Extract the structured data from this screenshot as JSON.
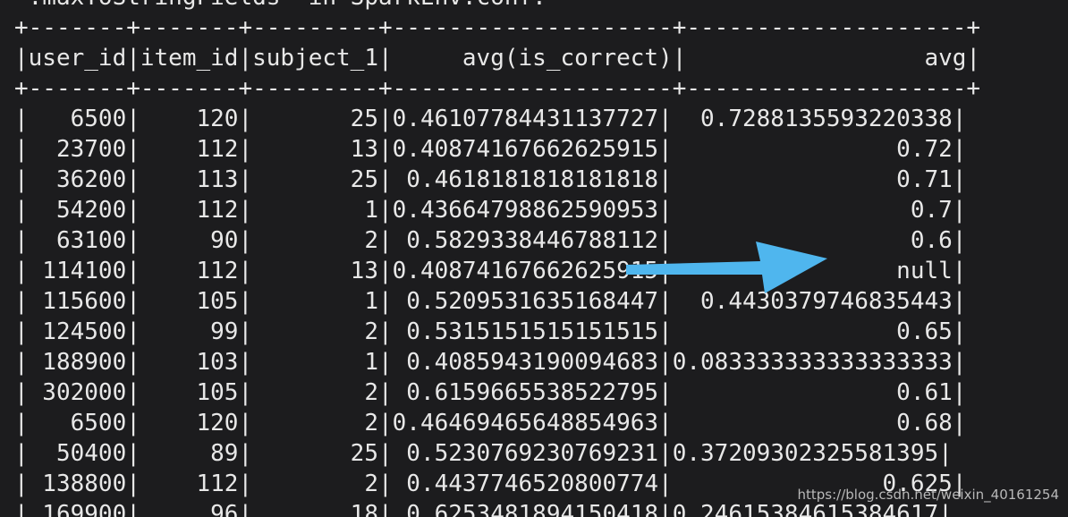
{
  "terminal": {
    "lines": [
      " .maxToStringFields' in SparkEnv.conf.",
      "+-------+-------+---------+--------------------+--------------------+",
      "|user_id|item_id|subject_1|     avg(is_correct)|                 avg|",
      "+-------+-------+---------+--------------------+--------------------+",
      "|   6500|    120|       25|0.46107784431137727|  0.7288135593220338|",
      "|  23700|    112|       13|0.40874167662625915|                0.72|",
      "|  36200|    113|       25| 0.4618181818181818|                0.71|",
      "|  54200|    112|        1|0.43664798862590953|                 0.7|",
      "|  63100|     90|        2| 0.5829338446788112|                 0.6|",
      "| 114100|    112|       13|0.40874167662625915|                null|",
      "| 115600|    105|        1| 0.5209531635168447|  0.4430379746835443|",
      "| 124500|     99|        2| 0.5315151515151515|                0.65|",
      "| 188900|    103|        1| 0.4085943190094683|0.083333333333333333|",
      "| 302000|    105|        2| 0.6159665538522795|                0.61|",
      "|   6500|    120|        2|0.46469465648854963|                0.68|",
      "|  50400|     89|       25| 0.5230769230769231|0.37209302325581395|",
      "| 138800|    112|        2| 0.4437746520800774|               0.625|",
      "| 169900|     96|       18| 0.6253481894150418|0.24615384615384617|"
    ]
  },
  "watermark": "https://blog.csdn.net/weixin_40161254",
  "colors": {
    "background": "#1c1c1e",
    "text": "#e8e8e8",
    "arrow": "#4fb6ee"
  },
  "icons": {
    "arrow": "right-arrow-icon"
  }
}
